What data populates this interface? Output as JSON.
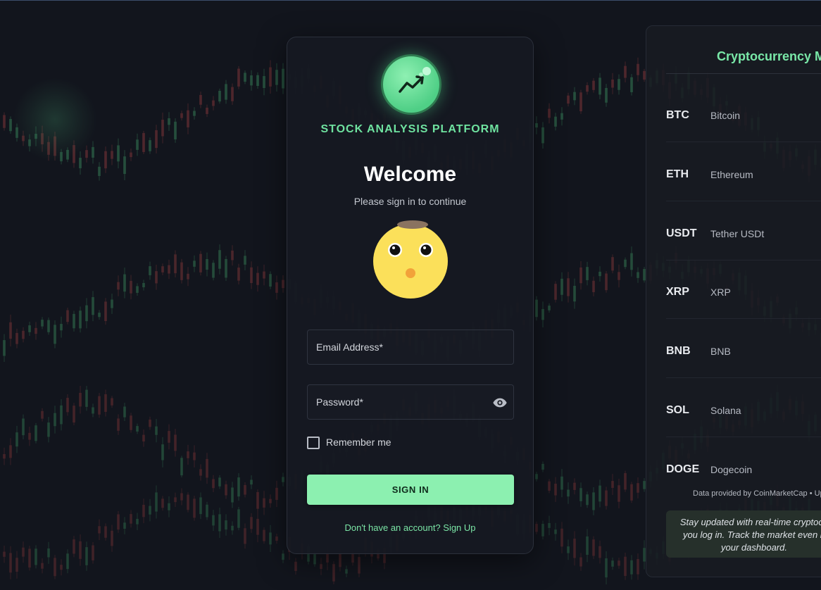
{
  "brand": {
    "name": "STOCK ANALYSIS PLATFORM",
    "logo_icon": "trending-up-icon"
  },
  "login": {
    "title": "Welcome",
    "subtitle": "Please sign in to continue",
    "email_label": "Email Address",
    "password_label": "Password",
    "required_mark": "*",
    "remember_label": "Remember me",
    "remember_checked": false,
    "signin_label": "SIGN IN",
    "signup_text": "Don't have an account? Sign Up"
  },
  "crypto_panel": {
    "title": "Cryptocurrency M",
    "items": [
      {
        "symbol": "BTC",
        "name": "Bitcoin"
      },
      {
        "symbol": "ETH",
        "name": "Ethereum"
      },
      {
        "symbol": "USDT",
        "name": "Tether USDt"
      },
      {
        "symbol": "XRP",
        "name": "XRP"
      },
      {
        "symbol": "BNB",
        "name": "BNB"
      },
      {
        "symbol": "SOL",
        "name": "Solana"
      },
      {
        "symbol": "DOGE",
        "name": "Dogecoin"
      }
    ],
    "footnote": "Data provided by CoinMarketCap • Upd",
    "promo": "Stay updated with real-time cryptocu you log in. Track the market even b your dashboard."
  },
  "colors": {
    "accent": "#6fe3a0",
    "button": "#8cf0b0",
    "background": "#12151d",
    "candle_up": "#2f6b4c",
    "candle_down": "#6b2f33"
  }
}
